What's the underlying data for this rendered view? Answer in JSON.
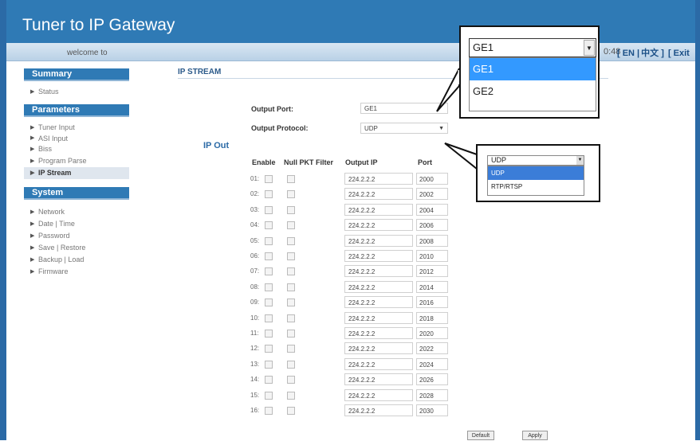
{
  "app": {
    "title": "Tuner to IP Gateway"
  },
  "topbar": {
    "welcome": "welcome to",
    "time": "0:48",
    "lang_en": "[ EN |",
    "lang_zh": "中文 ]",
    "exit": "[ Exit"
  },
  "sidebar": {
    "summary": {
      "title": "Summary",
      "items": [
        "Status"
      ]
    },
    "parameters": {
      "title": "Parameters",
      "items": [
        "Tuner Input",
        "ASI Input",
        "Biss",
        "Program Parse",
        "IP Stream"
      ]
    },
    "system": {
      "title": "System",
      "items": [
        "Network",
        "Date | Time",
        "Password",
        "Save | Restore",
        "Backup | Load",
        "Firmware"
      ]
    },
    "active_item": "IP Stream"
  },
  "main": {
    "section_title": "IP STREAM",
    "output_port_label": "Output Port:",
    "output_port_value": "GE1",
    "output_protocol_label": "Output Protocol:",
    "output_protocol_value": "UDP",
    "ip_out_label": "IP Out",
    "headers": {
      "enable": "Enable",
      "null_pkt": "Null PKT Filter",
      "output_ip": "Output IP",
      "port": "Port"
    },
    "rows": [
      {
        "n": "01:",
        "ip": "224.2.2.2",
        "port": "2000"
      },
      {
        "n": "02:",
        "ip": "224.2.2.2",
        "port": "2002"
      },
      {
        "n": "03:",
        "ip": "224.2.2.2",
        "port": "2004"
      },
      {
        "n": "04:",
        "ip": "224.2.2.2",
        "port": "2006"
      },
      {
        "n": "05:",
        "ip": "224.2.2.2",
        "port": "2008"
      },
      {
        "n": "06:",
        "ip": "224.2.2.2",
        "port": "2010"
      },
      {
        "n": "07:",
        "ip": "224.2.2.2",
        "port": "2012"
      },
      {
        "n": "08:",
        "ip": "224.2.2.2",
        "port": "2014"
      },
      {
        "n": "09:",
        "ip": "224.2.2.2",
        "port": "2016"
      },
      {
        "n": "10:",
        "ip": "224.2.2.2",
        "port": "2018"
      },
      {
        "n": "11:",
        "ip": "224.2.2.2",
        "port": "2020"
      },
      {
        "n": "12:",
        "ip": "224.2.2.2",
        "port": "2022"
      },
      {
        "n": "13:",
        "ip": "224.2.2.2",
        "port": "2024"
      },
      {
        "n": "14:",
        "ip": "224.2.2.2",
        "port": "2026"
      },
      {
        "n": "15:",
        "ip": "224.2.2.2",
        "port": "2028"
      },
      {
        "n": "16:",
        "ip": "224.2.2.2",
        "port": "2030"
      }
    ],
    "default_button": "Default",
    "apply_button": "Apply"
  },
  "callouts": {
    "port_dropdown": {
      "selected": "GE1",
      "options": [
        "GE1",
        "GE2"
      ],
      "highlighted": "GE1"
    },
    "protocol_dropdown": {
      "selected": "UDP",
      "options": [
        "UDP",
        "RTP/RTSP"
      ],
      "highlighted": "UDP"
    }
  },
  "colors": {
    "header_blue": "#2f7ab5",
    "highlight": "#3399ff"
  }
}
